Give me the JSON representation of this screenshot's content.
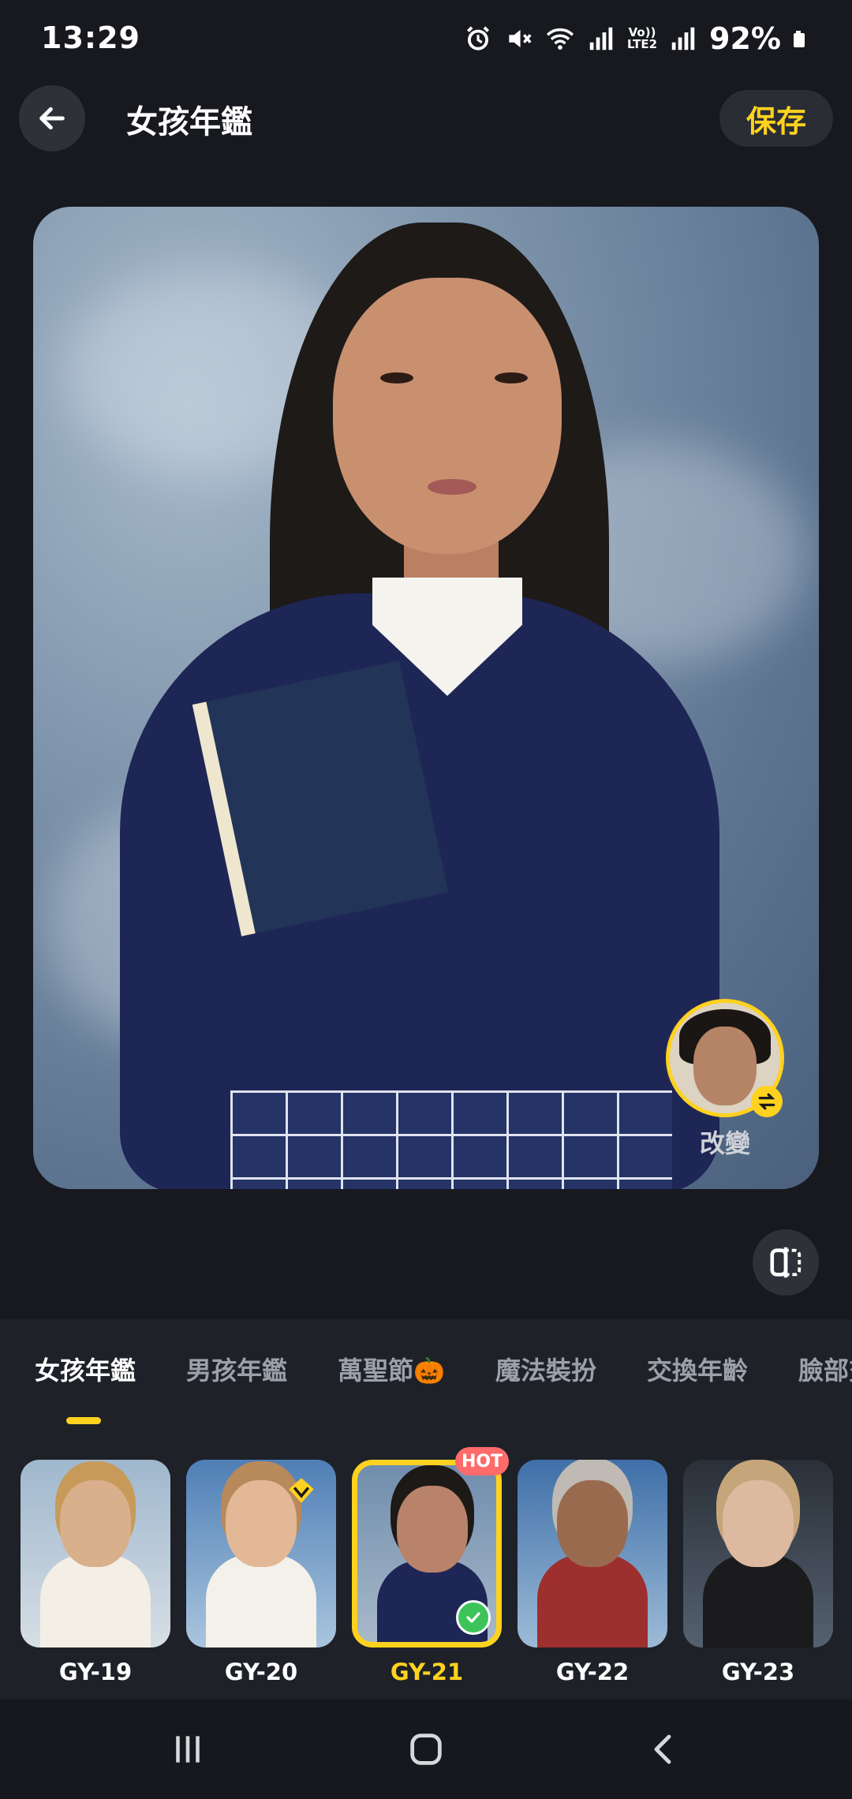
{
  "status_bar": {
    "time": "13:29",
    "battery": "92%",
    "network_label_top": "Vo))",
    "network_label_bottom": "LTE2",
    "icons": [
      "alarm-icon",
      "mute-icon",
      "wifi-icon",
      "signal-icon",
      "signal-icon",
      "battery-icon"
    ]
  },
  "header": {
    "back_icon": "arrow-left-icon",
    "title": "女孩年鑑",
    "save_label": "保存"
  },
  "photo": {
    "change_label": "改變"
  },
  "tabs": [
    {
      "label": "女孩年鑑",
      "active": true
    },
    {
      "label": "男孩年鑑",
      "active": false
    },
    {
      "label": "萬聖節🎃",
      "active": false
    },
    {
      "label": "魔法裝扮",
      "active": false
    },
    {
      "label": "交換年齡",
      "active": false
    },
    {
      "label": "臉部交",
      "active": false
    }
  ],
  "styles": [
    {
      "label": "GY-19",
      "selected": false
    },
    {
      "label": "GY-20",
      "selected": false,
      "vip": true
    },
    {
      "label": "GY-21",
      "selected": true,
      "badge": "HOT"
    },
    {
      "label": "GY-22",
      "selected": false
    },
    {
      "label": "GY-23",
      "selected": false
    }
  ],
  "colors": {
    "accent": "#ffd21f",
    "background": "#17191f",
    "hot": "#ff6a6a",
    "check": "#3cc45a"
  }
}
